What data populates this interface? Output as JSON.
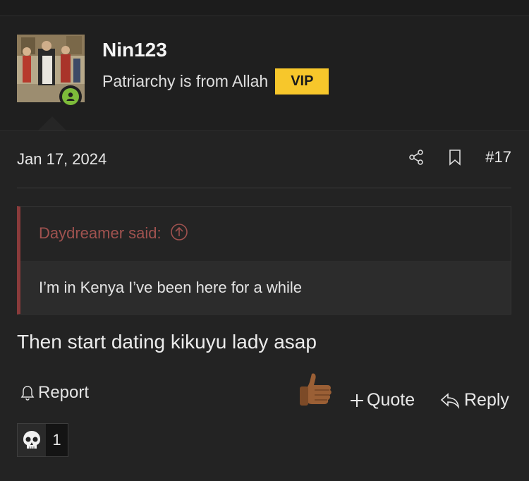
{
  "user": {
    "name": "Nin123",
    "title": "Patriarchy is from Allah",
    "badge": "VIP",
    "online": true,
    "avatar_icon": "avatar-image",
    "colors": {
      "badge_bg": "#f7c72b",
      "online": "#7dbb3a"
    }
  },
  "post": {
    "date": "Jan 17, 2024",
    "number": "#17",
    "actions": {
      "share_icon": "share-icon",
      "bookmark_icon": "bookmark-icon"
    },
    "quote": {
      "author_line": "Daydreamer said:",
      "text": "I’m in Kenya I’ve been here for a while",
      "expand_icon": "arrow-up-circle-icon",
      "accent": "#8a3b3b"
    },
    "message": "Then start dating kikuyu lady asap",
    "footer": {
      "report_label": "Report",
      "quote_label": "Quote",
      "reply_label": "Reply",
      "like_icon": "thumbs-up-icon"
    },
    "reactions": [
      {
        "icon": "skull-icon",
        "count": "1"
      }
    ]
  }
}
